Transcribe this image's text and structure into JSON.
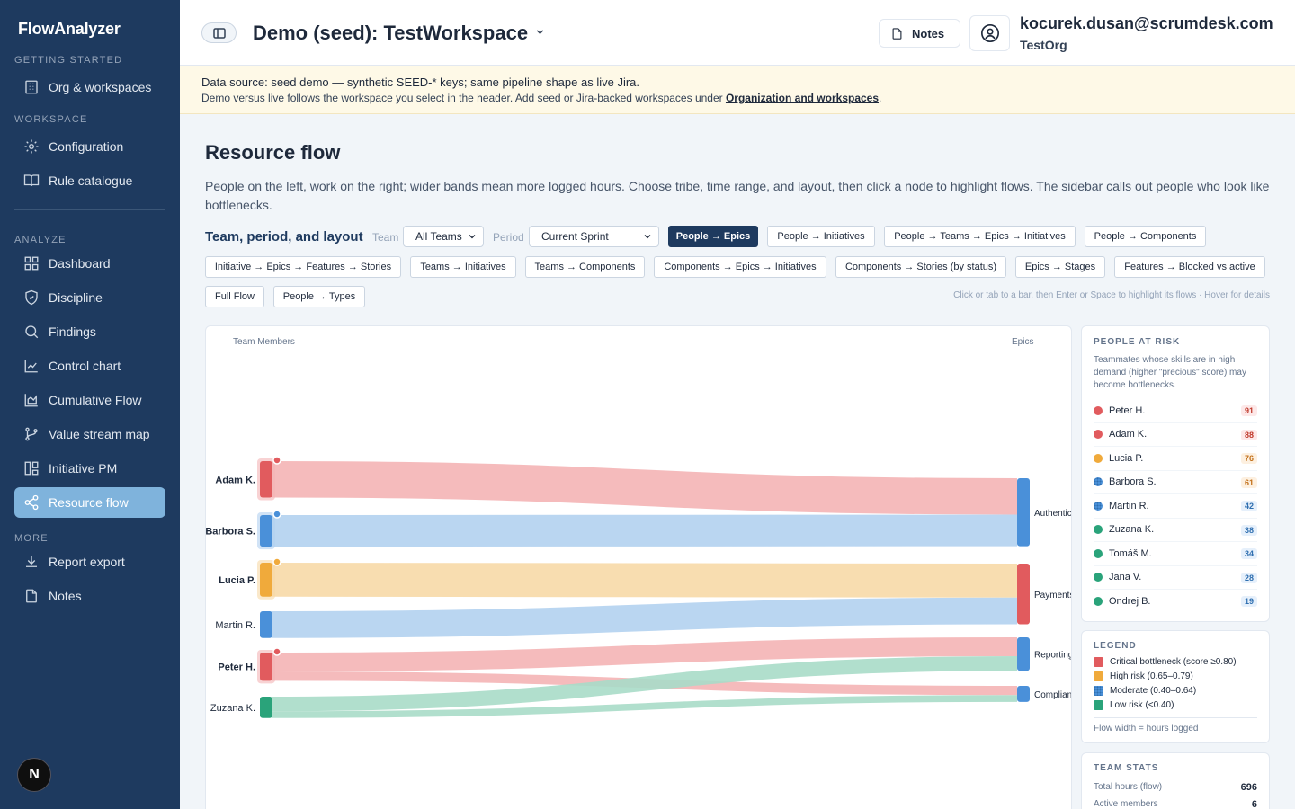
{
  "app": {
    "brand": "FlowAnalyzer"
  },
  "nav": {
    "sections": {
      "getting_started": "Getting started",
      "workspace": "Workspace",
      "analyze": "Analyze",
      "more": "More"
    },
    "items": [
      {
        "label": "Org & workspaces",
        "icon": "building-icon"
      },
      {
        "label": "Configuration",
        "icon": "gear-icon"
      },
      {
        "label": "Rule catalogue",
        "icon": "book-icon"
      },
      {
        "label": "Dashboard",
        "icon": "grid-icon"
      },
      {
        "label": "Discipline",
        "icon": "shield-icon"
      },
      {
        "label": "Findings",
        "icon": "search-icon"
      },
      {
        "label": "Control chart",
        "icon": "line-chart-icon"
      },
      {
        "label": "Cumulative Flow",
        "icon": "area-chart-icon"
      },
      {
        "label": "Value stream map",
        "icon": "git-branch-icon"
      },
      {
        "label": "Initiative PM",
        "icon": "layout-icon"
      },
      {
        "label": "Resource flow",
        "icon": "share-icon",
        "active": true
      },
      {
        "label": "Report export",
        "icon": "download-icon"
      },
      {
        "label": "Notes",
        "icon": "file-icon"
      }
    ],
    "badge": "N"
  },
  "header": {
    "workspace_title": "Demo (seed): TestWorkspace",
    "notes_label": "Notes",
    "user_email": "kocurek.dusan@scrumdesk.com",
    "user_org": "TestOrg"
  },
  "banner": {
    "line1": "Data source: seed demo — synthetic SEED-* keys; same pipeline shape as live Jira.",
    "line2": "Demo versus live follows the workspace you select in the header. Add seed or Jira-backed workspaces under ",
    "link": "Organization and workspaces",
    "line2_end": "."
  },
  "main": {
    "title": "Resource flow",
    "description": "People on the left, work on the right; wider bands mean more logged hours. Choose tribe, time range, and layout, then click a node to highlight flows. The sidebar calls out people who look like bottlenecks.",
    "controls_title": "Team, period, and layout",
    "team_label": "Team",
    "team_value": "All Teams",
    "period_label": "Period",
    "period_value": "Current Sprint",
    "layouts": [
      "People → Epics",
      "People → Initiatives",
      "People → Teams → Epics → Initiatives",
      "People → Components",
      "Initiative → Epics → Features → Stories",
      "Teams → Initiatives",
      "Teams → Components",
      "Components → Epics → Initiatives",
      "Components → Stories (by status)",
      "Epics → Stages",
      "Features → Blocked vs active",
      "Full Flow",
      "People → Types"
    ],
    "active_layout": "People → Epics",
    "hint": "Click or tab to a bar, then Enter or Space to highlight its flows · Hover for details"
  },
  "chart_data": {
    "type": "sankey",
    "left_header": "Team Members",
    "right_header": "Epics",
    "colors": {
      "critical": "#e15b5e",
      "high": "#f0aa3b",
      "moderate": "#4a90d9",
      "low": "#2aa37a"
    },
    "left_nodes": [
      {
        "name": "Adam K.",
        "risk": "critical",
        "bold": true,
        "flagged": true
      },
      {
        "name": "Barbora S.",
        "risk": "moderate",
        "bold": true,
        "flagged": true
      },
      {
        "name": "Lucia P.",
        "risk": "high",
        "bold": true,
        "flagged": true
      },
      {
        "name": "Martin R.",
        "risk": "moderate",
        "bold": false,
        "flagged": false
      },
      {
        "name": "Peter H.",
        "risk": "critical",
        "bold": true,
        "flagged": true
      },
      {
        "name": "Zuzana K.",
        "risk": "low",
        "bold": false,
        "flagged": false
      }
    ],
    "right_nodes": [
      {
        "name": "Authentication",
        "color": "moderate"
      },
      {
        "name": "Payments",
        "color": "critical"
      },
      {
        "name": "Reporting",
        "color": "moderate"
      },
      {
        "name": "Compliance",
        "color": "moderate"
      }
    ],
    "links": [
      {
        "source": "Adam K.",
        "target": "Authentication",
        "hours": 150
      },
      {
        "source": "Barbora S.",
        "target": "Authentication",
        "hours": 130
      },
      {
        "source": "Lucia P.",
        "target": "Payments",
        "hours": 140
      },
      {
        "source": "Martin R.",
        "target": "Payments",
        "hours": 110
      },
      {
        "source": "Peter H.",
        "target": "Reporting",
        "hours": 78
      },
      {
        "source": "Peter H.",
        "target": "Compliance",
        "hours": 38
      },
      {
        "source": "Zuzana K.",
        "target": "Reporting",
        "hours": 60
      },
      {
        "source": "Zuzana K.",
        "target": "Compliance",
        "hours": 28
      }
    ]
  },
  "risk_panel": {
    "title": "People at risk",
    "description": "Teammates whose skills are in high demand (higher \"precious\" score) may become bottlenecks.",
    "people": [
      {
        "name": "Peter H.",
        "score": "91",
        "level": "critical"
      },
      {
        "name": "Adam K.",
        "score": "88",
        "level": "critical"
      },
      {
        "name": "Lucia P.",
        "score": "76",
        "level": "high"
      },
      {
        "name": "Barbora S.",
        "score": "61",
        "level": "moderate"
      },
      {
        "name": "Martin R.",
        "score": "42",
        "level": "moderate"
      },
      {
        "name": "Zuzana K.",
        "score": "38",
        "level": "low"
      },
      {
        "name": "Tomáš M.",
        "score": "34",
        "level": "low"
      },
      {
        "name": "Jana V.",
        "score": "28",
        "level": "low"
      },
      {
        "name": "Ondrej B.",
        "score": "19",
        "level": "low"
      }
    ]
  },
  "legend": {
    "title": "Legend",
    "items": [
      {
        "label": "Critical bottleneck (score ≥0.80)",
        "color": "#e15b5e"
      },
      {
        "label": "High risk (0.65–0.79)",
        "color": "#f0aa3b"
      },
      {
        "label": "Moderate (0.40–0.64)",
        "color": "#4a90d9"
      },
      {
        "label": "Low risk (<0.40)",
        "color": "#2aa37a"
      }
    ],
    "footer": "Flow width = hours logged"
  },
  "team_stats": {
    "title": "Team stats",
    "rows": [
      {
        "label": "Total hours (flow)",
        "value": "696"
      },
      {
        "label": "Active members",
        "value": "6"
      }
    ]
  }
}
